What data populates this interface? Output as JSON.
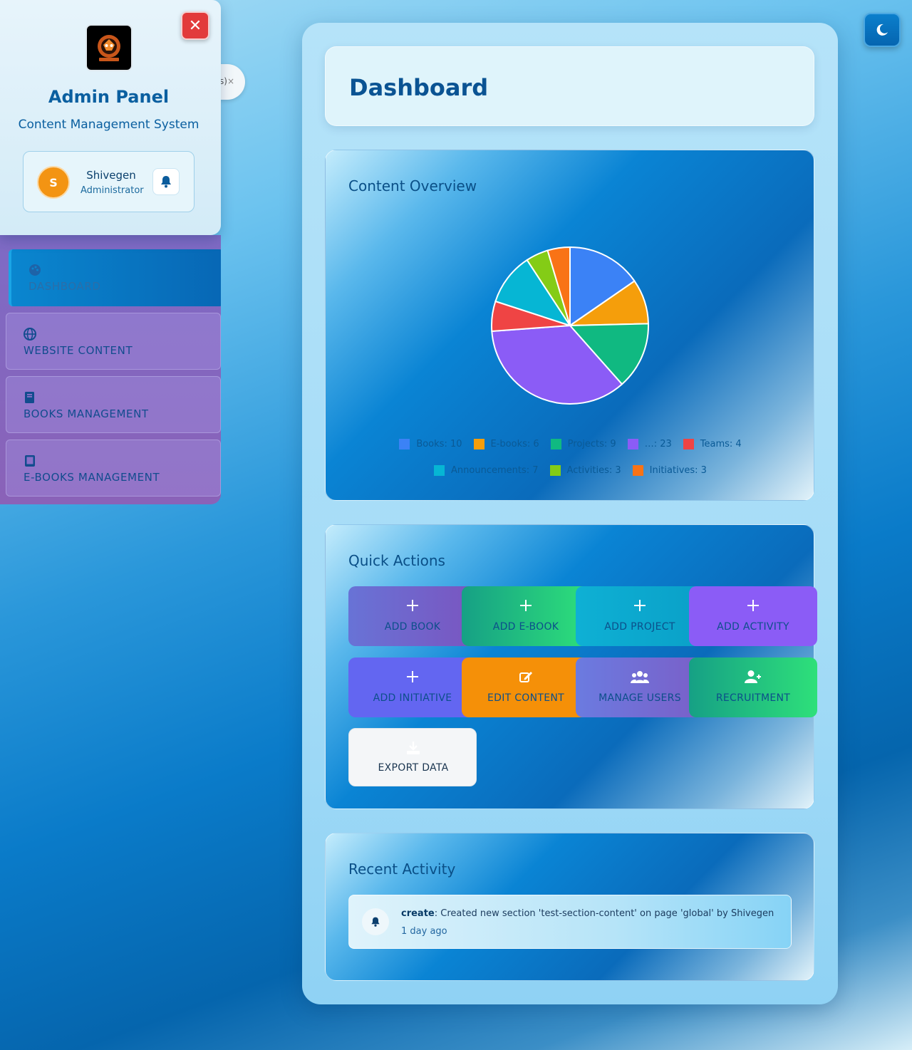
{
  "sidebar": {
    "title": "Admin Panel",
    "subtitle": "Content Management System",
    "user": {
      "initial": "S",
      "name": "Shivegen",
      "role": "Administrator"
    },
    "tag_fragment": "s)",
    "items": [
      {
        "label": "DASHBOARD",
        "icon": "palette-icon",
        "active": true
      },
      {
        "label": "WEBSITE CONTENT",
        "icon": "globe-icon",
        "active": false
      },
      {
        "label": "BOOKS MANAGEMENT",
        "icon": "book-icon",
        "active": false
      },
      {
        "label": "E-BOOKS MANAGEMENT",
        "icon": "tablet-icon",
        "active": false
      }
    ]
  },
  "theme_toggle": {
    "icon": "moon-icon"
  },
  "header": {
    "title": "Dashboard"
  },
  "content_overview": {
    "title": "Content Overview",
    "legend": [
      {
        "label": "Books: 10",
        "color": "#3b82f6"
      },
      {
        "label": "E-books: 6",
        "color": "#f59e0b"
      },
      {
        "label": "Projects: 9",
        "color": "#10b981"
      },
      {
        "label": "…: 23",
        "color": "#8b5cf6"
      },
      {
        "label": "Teams: 4",
        "color": "#ef4444"
      },
      {
        "label": "Announcements: 7",
        "color": "#06b6d4"
      },
      {
        "label": "Activities: 3",
        "color": "#84cc16"
      },
      {
        "label": "Initiatives: 3",
        "color": "#f97316"
      }
    ]
  },
  "chart_data": {
    "type": "pie",
    "categories": [
      "Books",
      "E-books",
      "Projects",
      "",
      "Teams",
      "Announcements",
      "Activities",
      "Initiatives"
    ],
    "values": [
      10,
      6,
      9,
      23,
      4,
      7,
      3,
      3
    ],
    "colors": [
      "#3b82f6",
      "#f59e0b",
      "#10b981",
      "#8b5cf6",
      "#ef4444",
      "#06b6d4",
      "#84cc16",
      "#f97316"
    ],
    "legend": "bottom"
  },
  "quick_actions": {
    "title": "Quick Actions",
    "buttons": [
      {
        "label": "ADD BOOK",
        "icon": "plus-icon"
      },
      {
        "label": "ADD E-BOOK",
        "icon": "plus-icon"
      },
      {
        "label": "ADD PROJECT",
        "icon": "plus-icon"
      },
      {
        "label": "ADD ACTIVITY",
        "icon": "plus-icon"
      },
      {
        "label": "ADD INITIATIVE",
        "icon": "plus-icon"
      },
      {
        "label": "EDIT CONTENT",
        "icon": "edit-icon"
      },
      {
        "label": "MANAGE USERS",
        "icon": "users-icon"
      },
      {
        "label": "RECRUITMENT",
        "icon": "user-plus-icon"
      },
      {
        "label": "EXPORT DATA",
        "icon": "download-icon"
      }
    ]
  },
  "recent_activity": {
    "title": "Recent Activity",
    "items": [
      {
        "action": "create",
        "description": ": Created new section 'test-section-content' on page 'global' by Shivegen",
        "time": "1 day ago"
      }
    ]
  }
}
